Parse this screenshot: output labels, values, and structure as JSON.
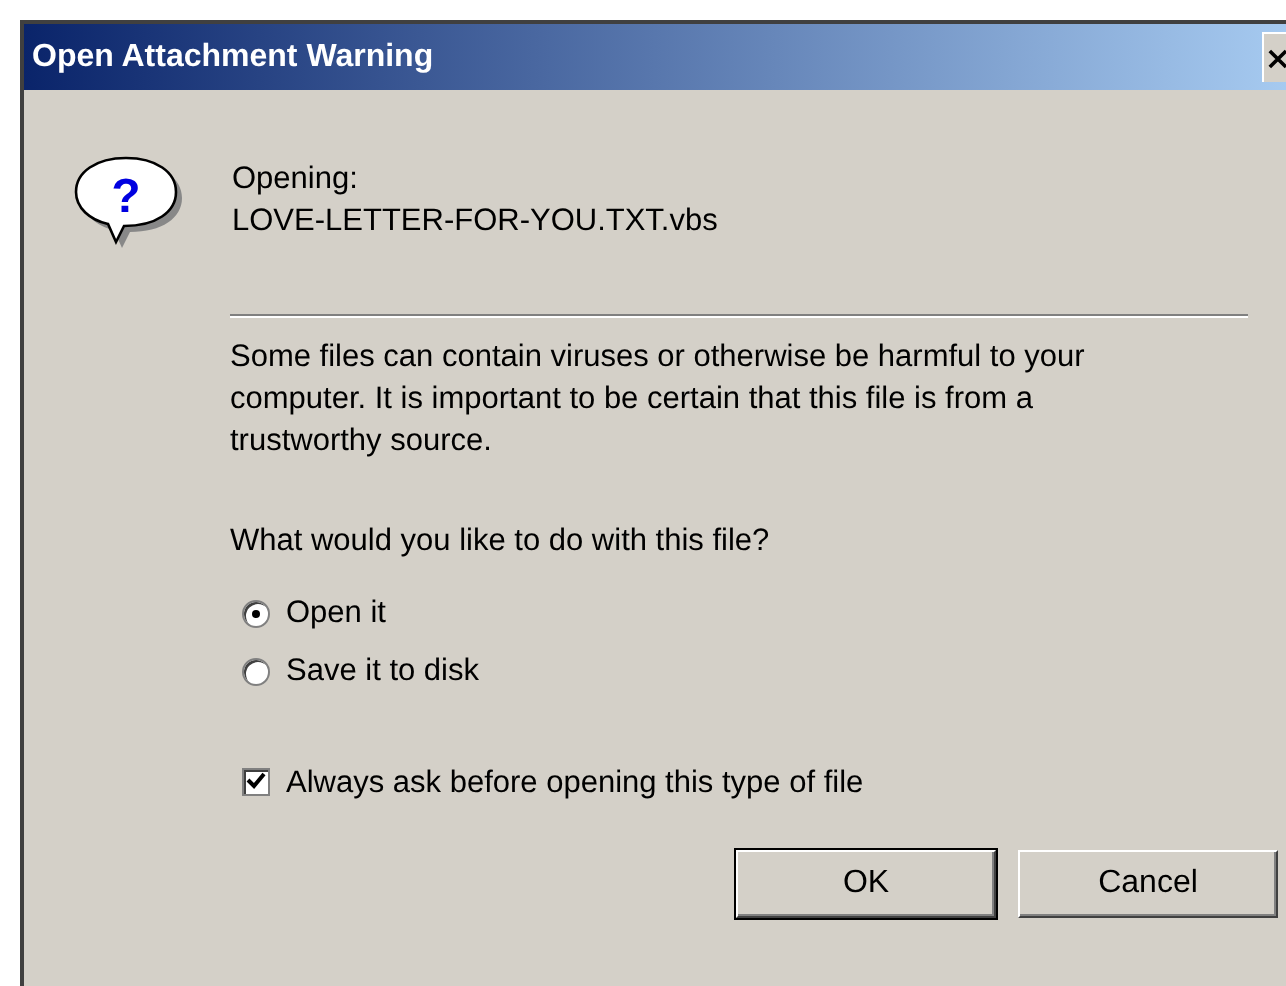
{
  "window": {
    "title": "Open Attachment Warning"
  },
  "header": {
    "icon_text": "?",
    "label": "Opening:",
    "filename": "LOVE-LETTER-FOR-YOU.TXT.vbs"
  },
  "message": "Some files can contain viruses or otherwise be harmful to your computer. It is important to be certain that this file is from a trustworthy source.",
  "question": "What would you like to do with this file?",
  "options": [
    {
      "label": "Open it",
      "selected": true
    },
    {
      "label": "Save it to disk",
      "selected": false
    }
  ],
  "always_ask": {
    "label": "Always ask before opening this type of file",
    "checked": true
  },
  "buttons": [
    {
      "label": "OK",
      "default": true
    },
    {
      "label": "Cancel",
      "default": false
    }
  ]
}
